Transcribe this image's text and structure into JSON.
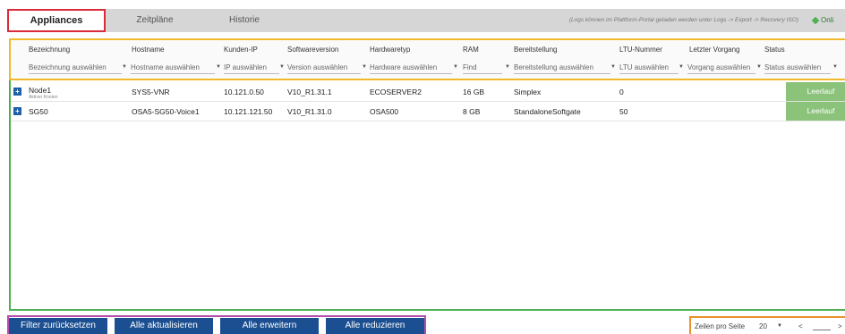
{
  "tabs": [
    {
      "label": "Appliances",
      "active": true
    },
    {
      "label": "Zeitpläne",
      "active": false
    },
    {
      "label": "Historie",
      "active": false
    }
  ],
  "logs_note": "(Logs können im Plattform-Portal geladen werden unter Logs -> Export -> Recovery ISO)",
  "online_label": "Onli",
  "columns": [
    {
      "title": "Bezeichnung",
      "filter": "Bezeichnung auswählen"
    },
    {
      "title": "Hostname",
      "filter": "Hostname auswählen"
    },
    {
      "title": "Kunden-IP",
      "filter": "IP auswählen"
    },
    {
      "title": "Softwareversion",
      "filter": "Version auswählen"
    },
    {
      "title": "Hardwaretyp",
      "filter": "Hardware auswählen"
    },
    {
      "title": "RAM",
      "filter": "Find"
    },
    {
      "title": "Bereitstellung",
      "filter": "Bereitstellung auswählen"
    },
    {
      "title": "LTU-Nummer",
      "filter": "LTU auswählen"
    },
    {
      "title": "Letzter Vorgang",
      "filter": "Vorgang auswählen"
    },
    {
      "title": "Status",
      "filter": "Status auswählen"
    }
  ],
  "rows": [
    {
      "name": "Node1",
      "sub": "Aktiver Knoten",
      "hostname": "SYS5-VNR",
      "ip": "10.121.0.50",
      "version": "V10_R1.31.1",
      "hardware": "ECOSERVER2",
      "ram": "16 GB",
      "deploy": "Simplex",
      "ltu": "0",
      "last": "",
      "status": "Leerlauf"
    },
    {
      "name": "SG50",
      "sub": "",
      "hostname": "OSA5-SG50-Voice1",
      "ip": "10.121.121.50",
      "version": "V10_R1.31.0",
      "hardware": "OSA500",
      "ram": "8 GB",
      "deploy": "StandaloneSoftgate",
      "ltu": "50",
      "last": "",
      "status": "Leerlauf"
    }
  ],
  "buttons": {
    "reset": "Filter zurücksetzen",
    "update_all": "Alle aktualisieren",
    "expand_all": "Alle erweitern",
    "collapse_all": "Alle reduzieren"
  },
  "pager": {
    "rows_label": "Zeilen pro Seite",
    "rows_value": "20",
    "prev": "<",
    "next": ">"
  },
  "icons": {
    "caret": "▼",
    "expand": "+"
  }
}
